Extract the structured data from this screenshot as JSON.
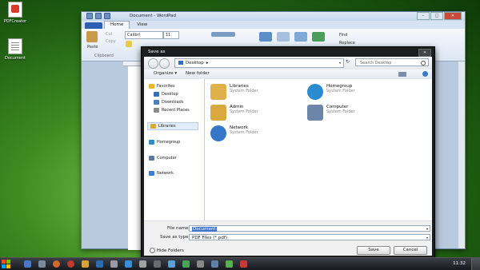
{
  "desktop": {
    "icons": [
      {
        "label": "PDFCreator",
        "icon": "pdf-file-icon"
      },
      {
        "label": "Document",
        "icon": "document-file-icon"
      }
    ]
  },
  "wordpad": {
    "title": "Document - WordPad",
    "tabs": [
      "Home",
      "View"
    ],
    "ribbon": {
      "paste": "Paste",
      "cut": "Cut",
      "copy": "Copy",
      "clipboard": "Clipboard",
      "font_name": "Calibri",
      "font_size": "11",
      "find": "Find",
      "replace": "Replace"
    }
  },
  "dialog": {
    "title": "Save as",
    "path": "Desktop",
    "search_placeholder": "Search Desktop",
    "toolbar": {
      "organize": "Organize ▾",
      "new_folder": "New folder"
    },
    "sidebar": [
      {
        "label": "Favorites",
        "icon": "star-icon",
        "color": "#e8b62c"
      },
      {
        "label": "Desktop",
        "icon": "desktop-icon",
        "color": "#3a6fb8"
      },
      {
        "label": "Downloads",
        "icon": "downloads-icon",
        "color": "#4f7fbf"
      },
      {
        "label": "Recent Places",
        "icon": "recent-places-icon",
        "color": "#8b8b8b"
      },
      {
        "label": "Libraries",
        "icon": "libraries-icon",
        "color": "#d9a93e"
      },
      {
        "label": "Homegroup",
        "icon": "homegroup-icon",
        "color": "#2f8ec9"
      },
      {
        "label": "Computer",
        "icon": "computer-icon",
        "color": "#5d7aa0"
      },
      {
        "label": "Network",
        "icon": "network-icon",
        "color": "#3b7fd0"
      }
    ],
    "items": [
      {
        "name": "Libraries",
        "type": "System Folder",
        "icon": "libraries-icon",
        "color": "#e0b04a"
      },
      {
        "name": "Homegroup",
        "type": "System Folder",
        "icon": "homegroup-icon",
        "color": "#2a8bd0"
      },
      {
        "name": "Admin",
        "type": "System Folder",
        "icon": "user-folder-icon",
        "color": "#d9a93e"
      },
      {
        "name": "Computer",
        "type": "System Folder",
        "icon": "computer-icon",
        "color": "#6d86a8"
      },
      {
        "name": "Network",
        "type": "System Folder",
        "icon": "network-icon",
        "color": "#3576c7"
      }
    ],
    "file_name_label": "File name:",
    "file_name_value": "Document",
    "save_type_label": "Save as type:",
    "save_type_value": "PDF Files (*.pdf)",
    "hide_folders": "Hide Folders",
    "save_button": "Save",
    "cancel_button": "Cancel"
  },
  "taskbar": {
    "clock": "11:32"
  }
}
